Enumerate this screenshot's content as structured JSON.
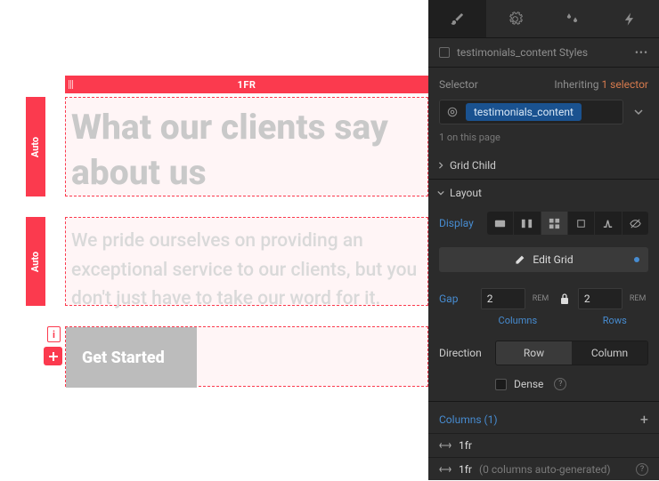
{
  "canvas": {
    "topTrackLabel": "1FR",
    "leftTrack1": "Auto",
    "leftTrack2": "Auto",
    "heading": "What our clients say about us",
    "paragraph": "We pride ourselves on providing an exceptional service to our clients, but you don't just have to take our word for it.",
    "button": "Get Started",
    "indicator": "i"
  },
  "panel": {
    "stylesLabel": "testimonials_content Styles",
    "selectorLabel": "Selector",
    "inheritingLabel": "Inheriting",
    "inheritingCount": "1 selector",
    "chip": "testimonials_content",
    "onPage": "1 on this page",
    "sections": {
      "gridChild": "Grid Child",
      "layout": "Layout"
    },
    "display": {
      "label": "Display",
      "editGrid": "Edit Grid"
    },
    "gap": {
      "label": "Gap",
      "colVal": "2",
      "colUnit": "REM",
      "rowVal": "2",
      "rowUnit": "REM",
      "columnsLabel": "Columns",
      "rowsLabel": "Rows"
    },
    "direction": {
      "label": "Direction",
      "row": "Row",
      "column": "Column"
    },
    "dense": {
      "label": "Dense"
    },
    "columns": {
      "header": "Columns (1)",
      "item1": "1fr",
      "item2Prefix": "1fr",
      "item2Suffix": "(0 columns auto-generated)"
    }
  }
}
